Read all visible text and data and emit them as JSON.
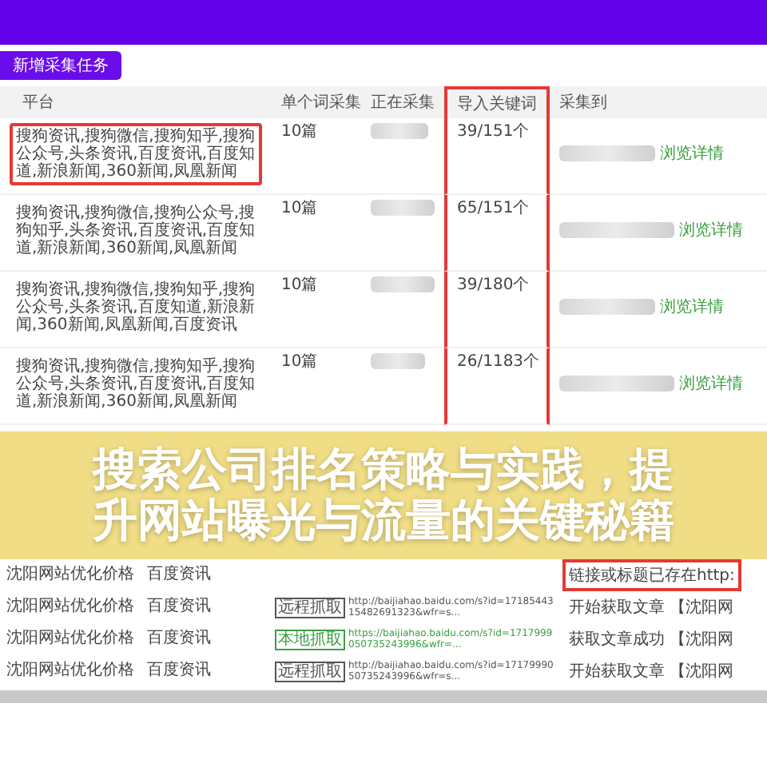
{
  "toolbar": {
    "add_button": "新增采集任务"
  },
  "task_table": {
    "columns": [
      {
        "label": "平台",
        "boxed": false
      },
      {
        "label": "单个词采集",
        "boxed": false
      },
      {
        "label": "正在采集",
        "boxed": false
      },
      {
        "label": "导入关键词",
        "boxed": true
      },
      {
        "label": "采集到",
        "boxed": false
      }
    ],
    "rows": [
      {
        "platform": "搜狗资讯,搜狗微信,搜狗知乎,搜狗公众号,头条资讯,百度资讯,百度知道,新浪新闻,360新闻,凤凰新闻",
        "boxed": true,
        "per_keyword": "10篇",
        "imported": "39/151个",
        "link": "浏览详情"
      },
      {
        "platform": "搜狗资讯,搜狗微信,搜狗公众号,搜狗知乎,头条资讯,百度资讯,百度知道,新浪新闻,360新闻,凤凰新闻",
        "boxed": false,
        "per_keyword": "10篇",
        "imported": "65/151个",
        "link": "浏览详情"
      },
      {
        "platform": "搜狗资讯,搜狗微信,搜狗知乎,搜狗公众号,头条资讯,百度知道,新浪新闻,360新闻,凤凰新闻,百度资讯",
        "boxed": false,
        "per_keyword": "10篇",
        "imported": "39/180个",
        "link": "浏览详情"
      },
      {
        "platform": "搜狗资讯,搜狗微信,搜狗知乎,搜狗公众号,头条资讯,百度资讯,百度知道,新浪新闻,360新闻,凤凰新闻",
        "boxed": false,
        "per_keyword": "10篇",
        "imported": "26/1183个",
        "link": "浏览详情"
      }
    ]
  },
  "banner": {
    "title": "搜索公司排名策略与实践，提升网站曝光与流量的关键秘籍"
  },
  "log_table": {
    "rows": [
      {
        "keyword": "沈阳网站优化价格",
        "source": "百度资讯",
        "status": "链接或标题已存在http:",
        "status_boxed": true
      },
      {
        "keyword": "沈阳网站优化价格",
        "source": "百度资讯",
        "tag": {
          "kind": "remote",
          "label": "远程抓取"
        },
        "url": "http://baijiahao.baidu.com/s?id=1718544315482691323&wfr=s...",
        "status": "开始获取文章 【沈阳网",
        "status_boxed": false
      },
      {
        "keyword": "沈阳网站优化价格",
        "source": "百度资讯",
        "tag": {
          "kind": "local",
          "label": "本地抓取"
        },
        "url": "https://baijiahao.baidu.com/s?id=1717999050735243996&wfr=...",
        "status": "获取文章成功 【沈阳网",
        "status_boxed": false
      },
      {
        "keyword": "沈阳网站优化价格",
        "source": "百度资讯",
        "tag": {
          "kind": "remote",
          "label": "远程抓取"
        },
        "url": "http://baijiahao.baidu.com/s?id=1717999050735243996&wfr=s...",
        "status": "开始获取文章 【沈阳网",
        "status_boxed": false
      }
    ]
  }
}
